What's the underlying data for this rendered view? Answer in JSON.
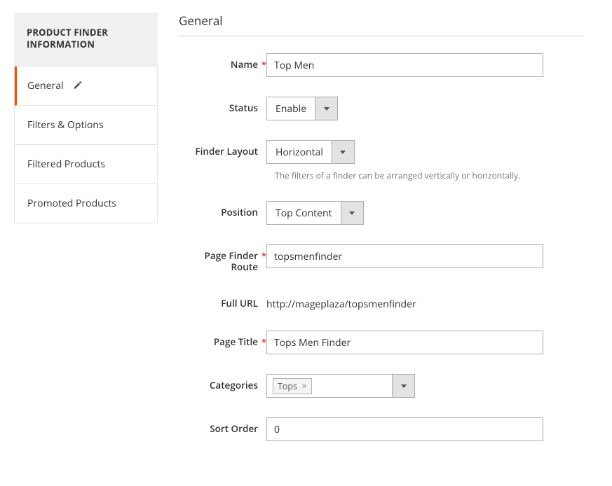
{
  "sidebar": {
    "title": "PRODUCT FINDER INFORMATION",
    "items": [
      {
        "label": "General",
        "active": true,
        "editable": true
      },
      {
        "label": "Filters & Options",
        "active": false,
        "editable": false
      },
      {
        "label": "Filtered Products",
        "active": false,
        "editable": false
      },
      {
        "label": "Promoted Products",
        "active": false,
        "editable": false
      }
    ]
  },
  "section_title": "General",
  "fields": {
    "name": {
      "label": "Name",
      "value": "Top Men",
      "required": true
    },
    "status": {
      "label": "Status",
      "value": "Enable",
      "required": false
    },
    "finder_layout": {
      "label": "Finder Layout",
      "value": "Horizontal",
      "help": "The filters of a finder can be arranged vertically or horizontally.",
      "required": false
    },
    "position": {
      "label": "Position",
      "value": "Top Content",
      "required": false
    },
    "page_finder_route": {
      "label": "Page Finder Route",
      "value": "topsmenfinder",
      "required": true
    },
    "full_url": {
      "label": "Full URL",
      "value": "http://mageplaza/topsmenfinder"
    },
    "page_title": {
      "label": "Page Title",
      "value": "Tops Men Finder",
      "required": true
    },
    "categories": {
      "label": "Categories",
      "selected": [
        "Tops"
      ],
      "required": false
    },
    "sort_order": {
      "label": "Sort Order",
      "value": "0",
      "required": false
    }
  }
}
